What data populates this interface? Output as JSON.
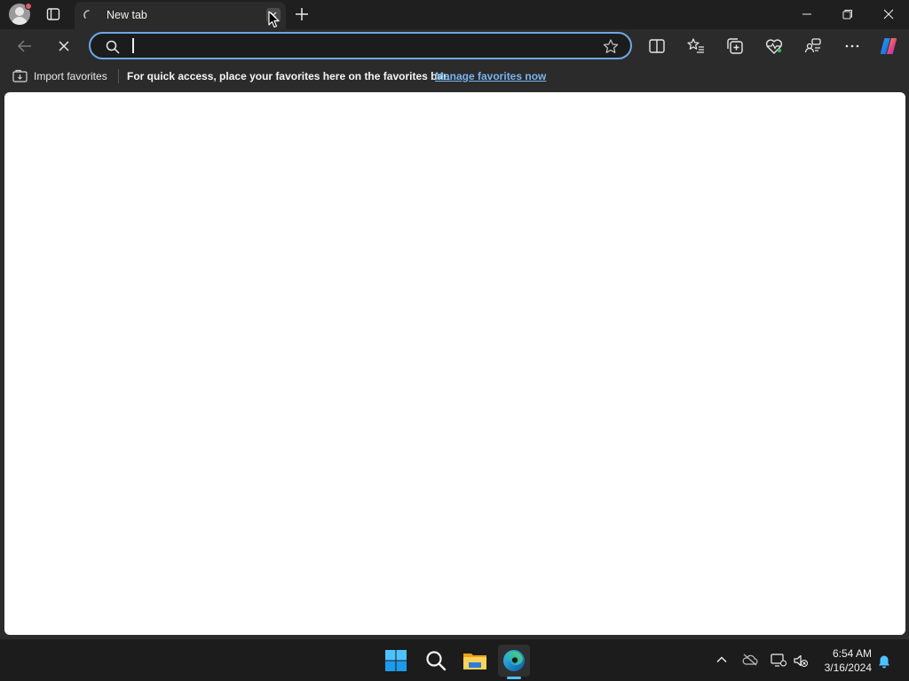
{
  "tab": {
    "title": "New tab"
  },
  "address_bar": {
    "value": "",
    "placeholder": ""
  },
  "favorites_bar": {
    "import_label": "Import favorites",
    "message": "For quick access, place your favorites here on the favorites bar.",
    "manage_link": "Manage favorites now"
  },
  "taskbar": {
    "time": "6:54 AM",
    "date": "3/16/2024"
  },
  "colors": {
    "accent": "#6ea7e3",
    "link": "#79b4ef",
    "chrome": "#2b2b2b",
    "taskbar_indicator": "#4cc2ff"
  }
}
